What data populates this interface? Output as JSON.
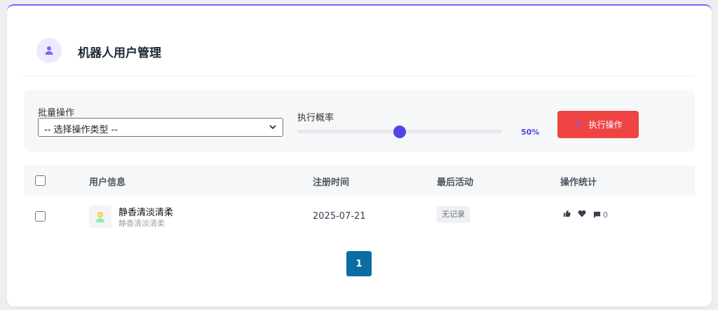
{
  "header": {
    "title": "机器人用户管理",
    "icon": "user-icon"
  },
  "toolbar": {
    "batch_label": "批量操作",
    "select_value": "-- 选择操作类型 --",
    "prob_label": "执行概率",
    "probability": 0.5,
    "prob_text": "50%",
    "exec_label": "执行操作",
    "exec_color": "#ef4444"
  },
  "table": {
    "headers": {
      "user": "用户信息",
      "registered": "注册时间",
      "last_active": "最后活动",
      "stats": "操作统计"
    },
    "rows": [
      {
        "name": "静香清淡清柔",
        "sub": "静香清淡清柔",
        "registered": "2025-07-21",
        "last_active": "无记录",
        "comments": "0"
      }
    ]
  },
  "pagination": {
    "current": "1"
  },
  "colors": {
    "accent": "#4f46e5",
    "top_border": "#8b5cf6",
    "pager": "#0a6ea4"
  }
}
